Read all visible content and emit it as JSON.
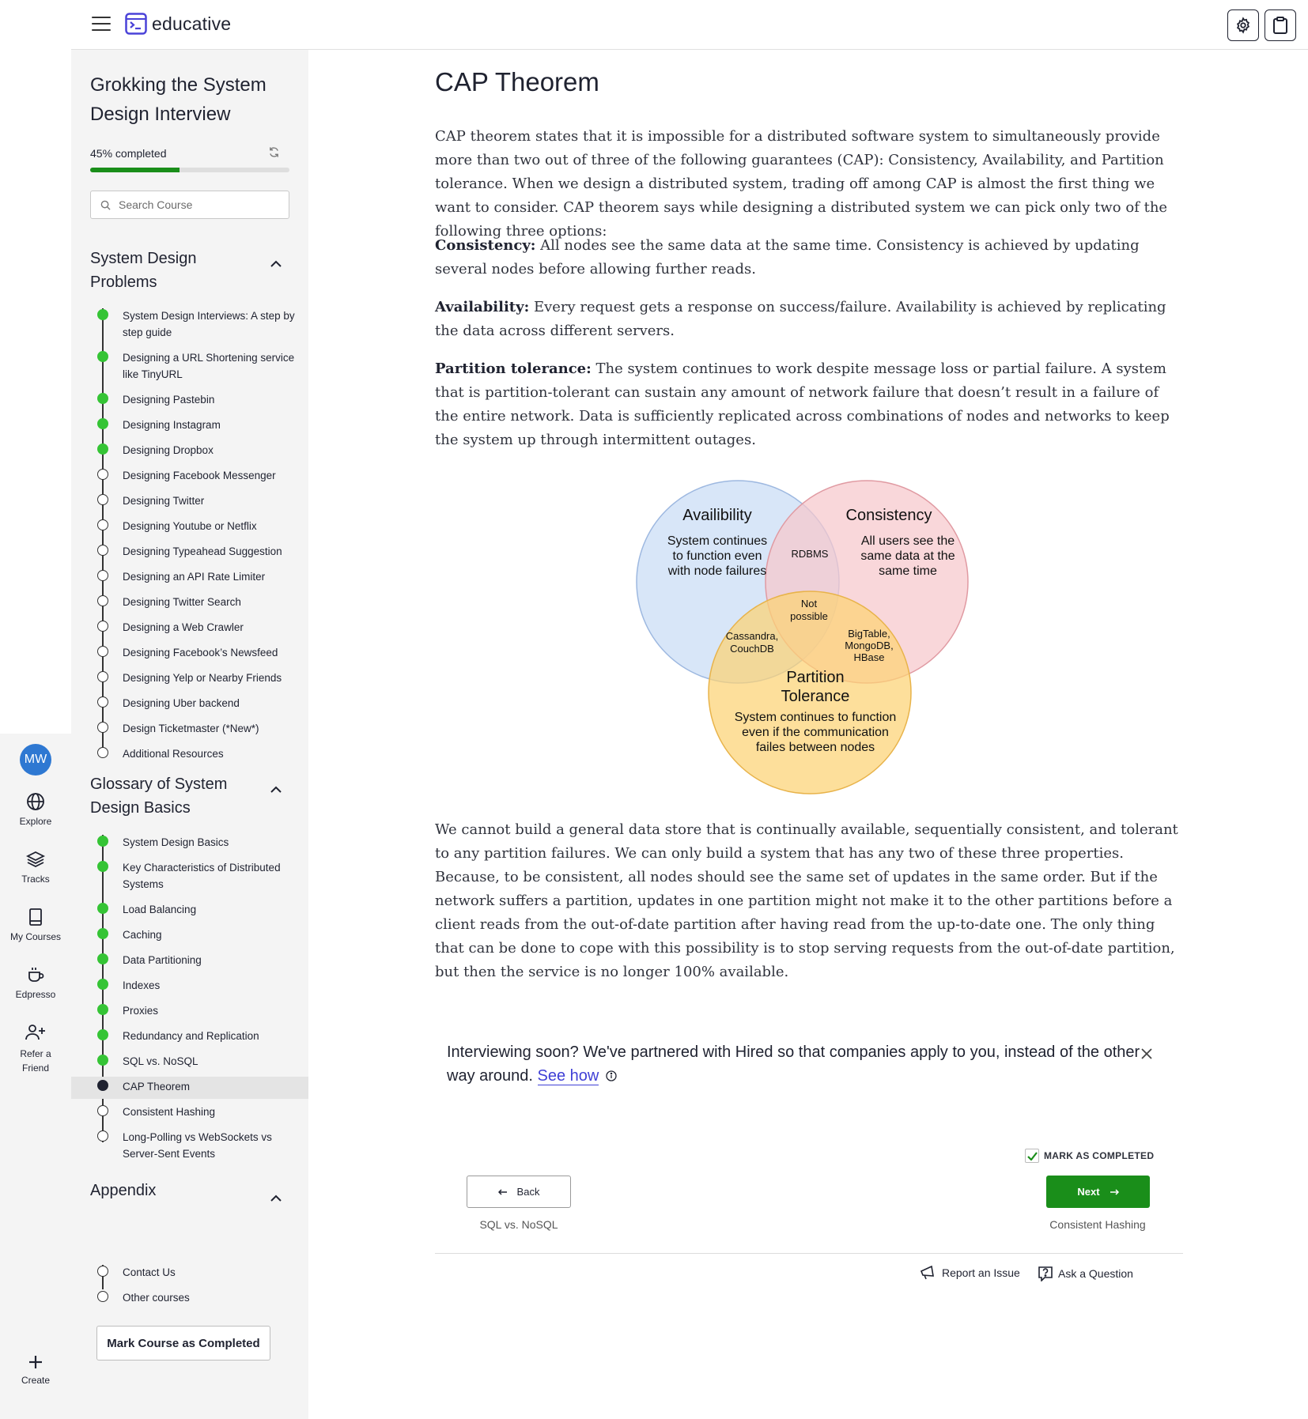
{
  "brand": {
    "name": "educative",
    "accent": "#1a8e1a"
  },
  "topbar": {
    "settings_icon": "gear-icon",
    "notes_icon": "clipboard-icon"
  },
  "rail": {
    "avatar": "MW",
    "items": [
      {
        "label": "Explore",
        "icon": "globe-icon"
      },
      {
        "label": "Tracks",
        "icon": "layers-icon"
      },
      {
        "label": "My Courses",
        "icon": "book-icon"
      },
      {
        "label": "Edpresso",
        "icon": "coffee-icon"
      },
      {
        "label": "Refer a Friend",
        "icon": "add-user-icon"
      },
      {
        "label": "Create",
        "icon": "plus-icon"
      }
    ]
  },
  "sidebar": {
    "course_title": "Grokking the System Design Interview",
    "progress_label": "45% completed",
    "progress_percent": 45,
    "search_placeholder": "Search Course",
    "sections": [
      {
        "title": "System Design Problems",
        "lessons": [
          {
            "label": "System Design Interviews: A step by step guide",
            "status": "done"
          },
          {
            "label": "Designing a URL Shortening service like TinyURL",
            "status": "done"
          },
          {
            "label": "Designing Pastebin",
            "status": "done"
          },
          {
            "label": "Designing Instagram",
            "status": "done"
          },
          {
            "label": "Designing Dropbox",
            "status": "done"
          },
          {
            "label": "Designing Facebook Messenger",
            "status": "todo"
          },
          {
            "label": "Designing Twitter",
            "status": "todo"
          },
          {
            "label": "Designing Youtube or Netflix",
            "status": "todo"
          },
          {
            "label": "Designing Typeahead Suggestion",
            "status": "todo"
          },
          {
            "label": "Designing an API Rate Limiter",
            "status": "todo"
          },
          {
            "label": "Designing Twitter Search",
            "status": "todo"
          },
          {
            "label": "Designing a Web Crawler",
            "status": "todo"
          },
          {
            "label": "Designing Facebook’s Newsfeed",
            "status": "todo"
          },
          {
            "label": "Designing Yelp or Nearby Friends",
            "status": "todo"
          },
          {
            "label": "Designing Uber backend",
            "status": "todo"
          },
          {
            "label": "Design Ticketmaster (*New*)",
            "status": "todo"
          },
          {
            "label": "Additional Resources",
            "status": "todo"
          }
        ]
      },
      {
        "title": "Glossary of System Design Basics",
        "lessons": [
          {
            "label": "System Design Basics",
            "status": "done"
          },
          {
            "label": "Key Characteristics of Distributed Systems",
            "status": "done"
          },
          {
            "label": "Load Balancing",
            "status": "done"
          },
          {
            "label": "Caching",
            "status": "done"
          },
          {
            "label": "Data Partitioning",
            "status": "done"
          },
          {
            "label": "Indexes",
            "status": "done"
          },
          {
            "label": "Proxies",
            "status": "done"
          },
          {
            "label": "Redundancy and Replication",
            "status": "done"
          },
          {
            "label": "SQL vs. NoSQL",
            "status": "done"
          },
          {
            "label": "CAP Theorem",
            "status": "current"
          },
          {
            "label": "Consistent Hashing",
            "status": "todo"
          },
          {
            "label": "Long-Polling vs WebSockets vs Server-Sent Events",
            "status": "todo"
          }
        ]
      },
      {
        "title": "Appendix",
        "lessons": [
          {
            "label": "Contact Us",
            "status": "todo"
          },
          {
            "label": "Other courses",
            "status": "todo"
          }
        ]
      }
    ],
    "mark_course_label": "Mark Course as Completed"
  },
  "content": {
    "title": "CAP Theorem",
    "intro": "CAP theorem states that it is impossible for a distributed software system to simultaneously provide more than two out of three of the following guarantees (CAP): Consistency, Availability, and Partition tolerance. When we design a distributed system, trading off among CAP is almost the first thing we want to consider. CAP theorem says while designing a distributed system we can pick only two of the following three options:",
    "terms": [
      {
        "term": "Consistency:",
        "text": " All nodes see the same data at the same time. Consistency is achieved by updating several nodes before allowing further reads."
      },
      {
        "term": "Availability:",
        "text": " Every request gets a response on success/failure. Availability is achieved by replicating the data across different servers."
      },
      {
        "term": "Partition tolerance:",
        "text": " The system continues to work despite message loss or partial failure. A system that is partition-tolerant can sustain any amount of network failure that doesn’t result in a failure of the entire network. Data is sufficiently replicated across combinations of nodes and networks to keep the system up through intermittent outages."
      }
    ],
    "conclusion": "We cannot build a general data store that is continually available, sequentially consistent, and tolerant to any partition failures. We can only build a system that has any two of these three properties. Because, to be consistent, all nodes should see the same set of updates in the same order. But if the network suffers a partition, updates in one partition might not make it to the other partitions before a client reads from the out-of-date partition after having read from the up-to-date one. The only thing that can be done to cope with this possibility is to stop serving requests from the out-of-date partition, but then the service is no longer 100% available."
  },
  "venn": {
    "availability": {
      "title": "Availibility",
      "desc": [
        "System continues",
        "to function even",
        "with node failures"
      ],
      "color": "#c9dcf5"
    },
    "consistency": {
      "title": "Consistency",
      "desc": [
        "All users see the",
        "same data at the",
        "same time"
      ],
      "color": "#f6c7cc"
    },
    "partition": {
      "title": [
        "Partition",
        "Tolerance"
      ],
      "desc": [
        "System continues to function",
        "even if the communication",
        "failes between nodes"
      ],
      "color": "#fcd274"
    },
    "ac": "RDBMS",
    "center": [
      "Not",
      "possible"
    ],
    "ap": [
      "Cassandra,",
      "CouchDB"
    ],
    "cp": [
      "BigTable,",
      "MongoDB,",
      "HBase"
    ]
  },
  "promo": {
    "text": "Interviewing soon? We've partnered with Hired so that companies apply to you, instead of the other way around. ",
    "link": "See how"
  },
  "nav": {
    "mark_completed": "MARK AS COMPLETED",
    "back_label": "Back",
    "back_target": "SQL vs. NoSQL",
    "next_label": "Next",
    "next_target": "Consistent Hashing",
    "report_issue": "Report an Issue",
    "ask_question": "Ask a Question"
  }
}
